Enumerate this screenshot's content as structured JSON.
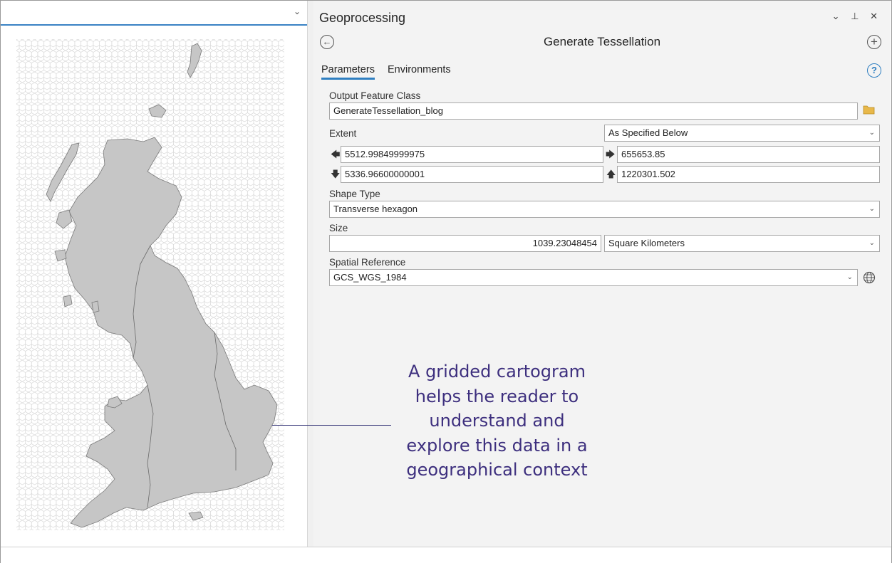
{
  "geoprocessing": {
    "pane_title": "Geoprocessing",
    "window_controls": "⌄ ⊥ ✕",
    "tool_name": "Generate Tessellation",
    "tabs": [
      "Parameters",
      "Environments"
    ],
    "help_label": "?",
    "output_feature_class": {
      "label": "Output Feature Class",
      "value": "GenerateTessellation_blog"
    },
    "extent": {
      "label": "Extent",
      "mode": "As Specified Below",
      "left": "5512.99849999975",
      "right": "655653.85",
      "bottom": "5336.96600000001",
      "top": "1220301.502"
    },
    "shape_type": {
      "label": "Shape Type",
      "value": "Transverse hexagon"
    },
    "size": {
      "label": "Size",
      "value": "1039.23048454",
      "unit": "Square Kilometers"
    },
    "spatial_reference": {
      "label": "Spatial Reference",
      "value": "GCS_WGS_1984"
    }
  },
  "annotation": {
    "lines": [
      "A gridded cartogram",
      "helps the reader to",
      "understand and",
      "explore this data in a",
      "geographical context"
    ]
  },
  "colors": {
    "accent": "#2f7fc1",
    "annotation_text": "#3d2f7e",
    "land_fill": "#c6c6c6",
    "hex_stroke": "#d4d4d4"
  },
  "icons": [
    "chevron-down-icon",
    "back-arrow-icon",
    "add-icon",
    "help-icon",
    "folder-icon",
    "globe-icon",
    "arrow-left-icon",
    "arrow-right-icon",
    "arrow-down-icon",
    "arrow-up-icon"
  ]
}
